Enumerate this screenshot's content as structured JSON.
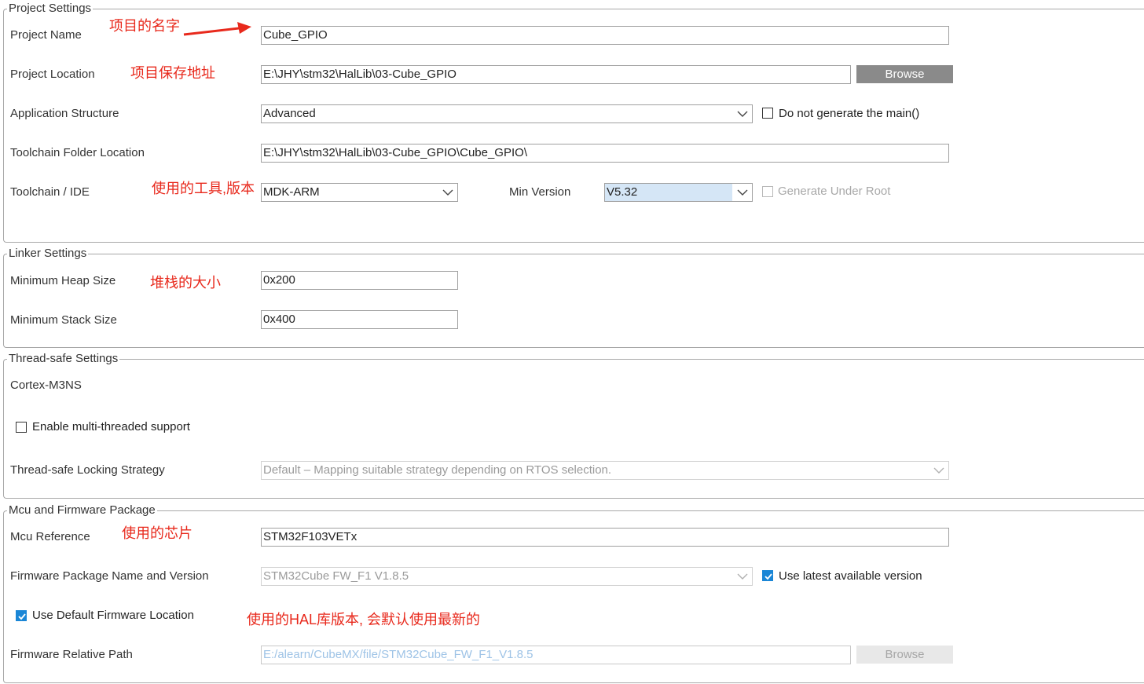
{
  "project_settings": {
    "title": "Project Settings",
    "project_name": {
      "label": "Project Name",
      "value": "Cube_GPIO",
      "note": "项目的名字"
    },
    "project_location": {
      "label": "Project Location",
      "value": "E:\\JHY\\stm32\\HalLib\\03-Cube_GPIO",
      "browse": "Browse",
      "note": "项目保存地址"
    },
    "application_structure": {
      "label": "Application Structure",
      "value": "Advanced",
      "checkbox_label": "Do not generate the main()",
      "checked": false
    },
    "toolchain_folder": {
      "label": "Toolchain Folder Location",
      "value": "E:\\JHY\\stm32\\HalLib\\03-Cube_GPIO\\Cube_GPIO\\"
    },
    "toolchain_ide": {
      "label": "Toolchain / IDE",
      "value": "MDK-ARM",
      "note": "使用的工具,版本",
      "min_version_label": "Min Version",
      "min_version_value": "V5.32",
      "generate_under_root": "Generate Under Root",
      "generate_under_root_checked": false
    }
  },
  "linker_settings": {
    "title": "Linker Settings",
    "heap": {
      "label": "Minimum Heap Size",
      "value": "0x200",
      "note": "堆栈的大小"
    },
    "stack": {
      "label": "Minimum Stack Size",
      "value": "0x400"
    }
  },
  "thread_safe": {
    "title": "Thread-safe Settings",
    "core": "Cortex-M3NS",
    "enable_label": "Enable multi-threaded support",
    "enable_checked": false,
    "strategy_label": "Thread-safe Locking Strategy",
    "strategy_value": "Default  –  Mapping suitable strategy depending on RTOS selection."
  },
  "mcu_firmware": {
    "title": "Mcu and Firmware Package",
    "mcu_reference": {
      "label": "Mcu Reference",
      "value": "STM32F103VETx",
      "note": "使用的芯片"
    },
    "firmware_package": {
      "label": "Firmware Package Name and Version",
      "value": "STM32Cube FW_F1 V1.8.5",
      "latest_label": "Use latest available version",
      "latest_checked": true
    },
    "default_location": {
      "label": "Use Default Firmware Location",
      "checked": true,
      "note": "使用的HAL库版本, 会默认使用最新的"
    },
    "relative_path": {
      "label": "Firmware Relative Path",
      "value": "E:/alearn/CubeMX/file/STM32Cube_FW_F1_V1.8.5",
      "browse": "Browse"
    }
  },
  "colors": {
    "annotation": "#e8291c",
    "check_blue": "#1a86d6",
    "browse_gray": "#8a8a8a"
  },
  "icons": [
    "annotation-arrow-icon",
    "chevron-down-icon",
    "checkmark-icon"
  ]
}
